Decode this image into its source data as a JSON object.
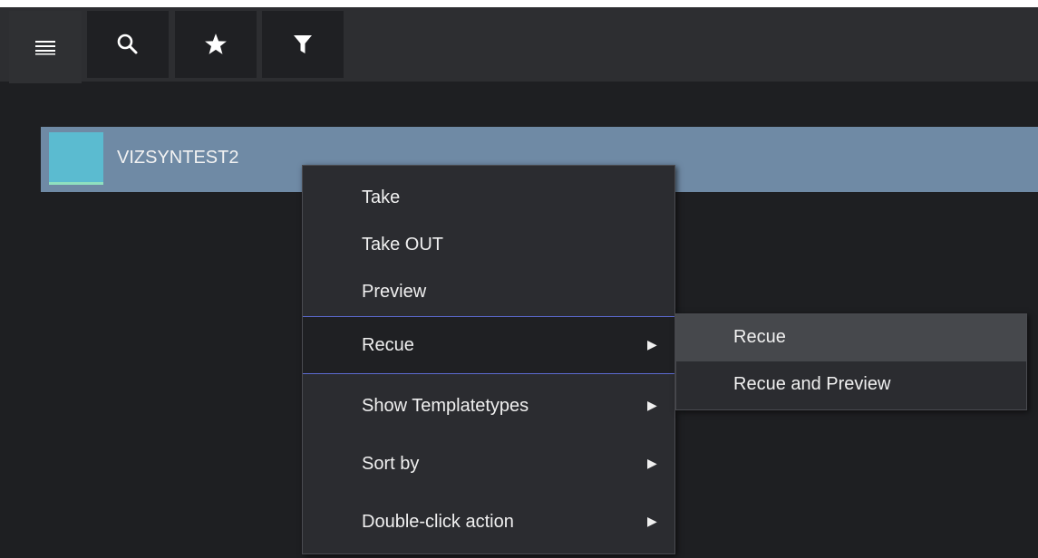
{
  "toolbar": {
    "buttons": [
      {
        "icon": "hamburger-menu-icon"
      },
      {
        "icon": "search-icon"
      },
      {
        "icon": "star-icon"
      },
      {
        "icon": "filter-icon"
      }
    ]
  },
  "list": {
    "items": [
      {
        "title": "VIZSYNTEST2",
        "color": "#5bbbd0"
      }
    ]
  },
  "context_menu": {
    "items": [
      {
        "label": "Take"
      },
      {
        "label": "Take OUT"
      },
      {
        "label": "Preview"
      },
      {
        "label": "Recue",
        "submenu": true
      },
      {
        "label": "Show Templatetypes",
        "submenu": true
      },
      {
        "label": "Sort by",
        "submenu": true
      },
      {
        "label": "Double-click action",
        "submenu": true
      }
    ],
    "arrow": "▶"
  },
  "submenu": {
    "items": [
      {
        "label": "Recue"
      },
      {
        "label": "Recue and Preview"
      }
    ]
  },
  "colors": {
    "background": "#1e1f22",
    "selection": "#6f8aa5",
    "menu_bg": "#2b2c30",
    "active_border": "#5c6ad0"
  }
}
